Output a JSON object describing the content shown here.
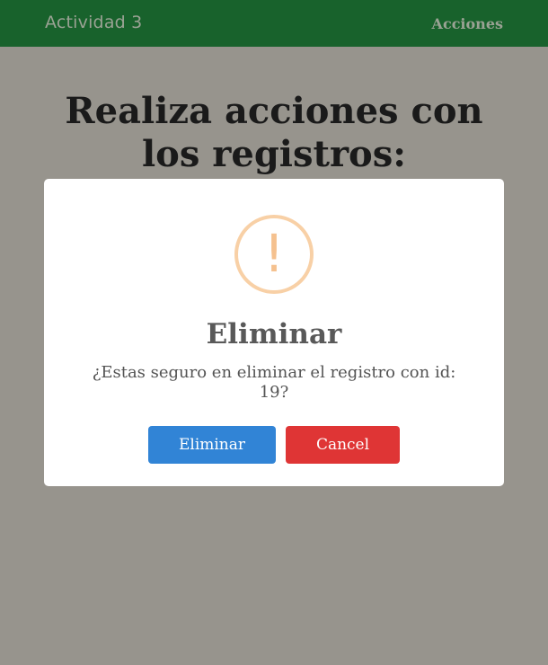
{
  "navbar": {
    "brand": "Actividad 3",
    "link": "Acciones"
  },
  "page": {
    "title": "Realiza acciones con los registros:"
  },
  "modal": {
    "icon": "exclamation-icon",
    "icon_glyph": "!",
    "title": "Eliminar",
    "message": "¿Estas seguro en eliminar el registro con id: 19?",
    "confirm_label": "Eliminar",
    "cancel_label": "Cancel"
  },
  "colors": {
    "navbar": "#18622c",
    "overlay": "#97948d",
    "warning": "#f8d0a6",
    "confirm": "#3184d6",
    "cancel": "#df3535"
  }
}
